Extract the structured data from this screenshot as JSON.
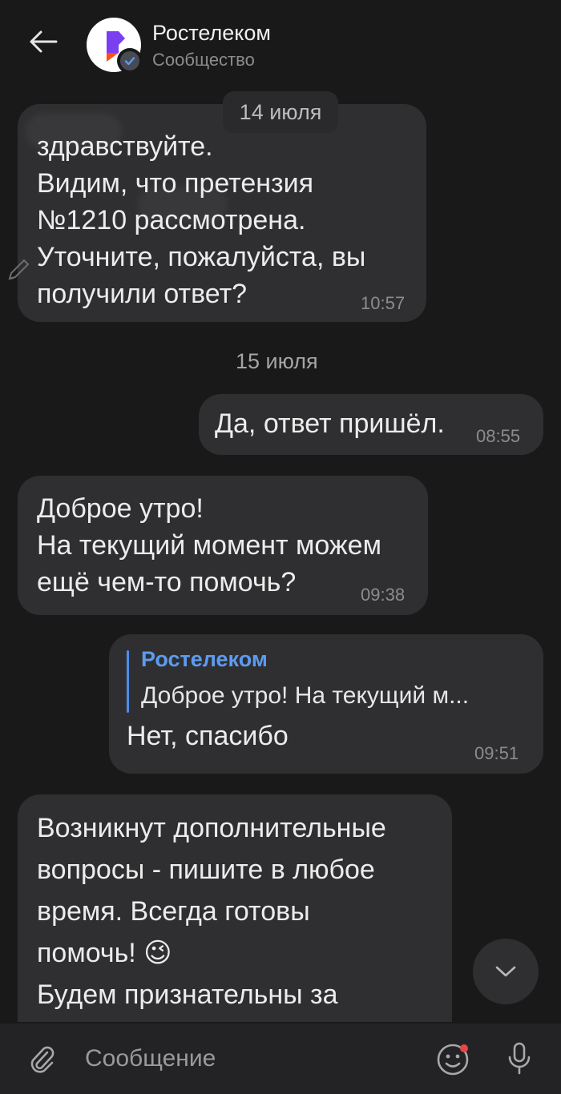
{
  "header": {
    "title": "Ростелеком",
    "subtitle": "Сообщество"
  },
  "dates": {
    "first": "14 июля",
    "second": "15 июля"
  },
  "messages": [
    {
      "direction": "incoming",
      "text": "здравствуйте.\nВидим, что претензия\n№1210         рассмотрена.\nУточните, пожалуйста, вы\nполучили ответ?",
      "time": "10:57"
    },
    {
      "direction": "outgoing",
      "text": "Да, ответ пришёл.",
      "time": "08:55"
    },
    {
      "direction": "incoming",
      "text": "Доброе утро!\nНа текущий момент можем\nещё чем-то помочь?",
      "time": "09:38"
    },
    {
      "direction": "outgoing",
      "reply_to": {
        "author": "Ростелеком",
        "text": "Доброе утро! На текущий м..."
      },
      "text": "Нет, спасибо",
      "time": "09:51"
    },
    {
      "direction": "incoming",
      "text": "Возникнут дополнительные\nвопросы - пишите в любое\nвремя. Всегда готовы\nпомочь! 😉\nБудем признательны за\nоценку нашей консультации",
      "time": ""
    }
  ],
  "composer": {
    "placeholder": "Сообщение"
  },
  "icons": {
    "back": "arrow-left-icon",
    "avatar": "rostelecom-logo",
    "verified": "verified-check-icon",
    "scroll": "chevron-down-icon",
    "attach": "paperclip-icon",
    "emoji": "smiley-icon",
    "mic": "microphone-icon"
  },
  "colors": {
    "background": "#19191a",
    "bubble": "#2f2f31",
    "accent": "#5d9bf0",
    "logo_purple": "#7b3ff2",
    "logo_orange": "#ff4f12",
    "notify_dot": "#e64646"
  }
}
